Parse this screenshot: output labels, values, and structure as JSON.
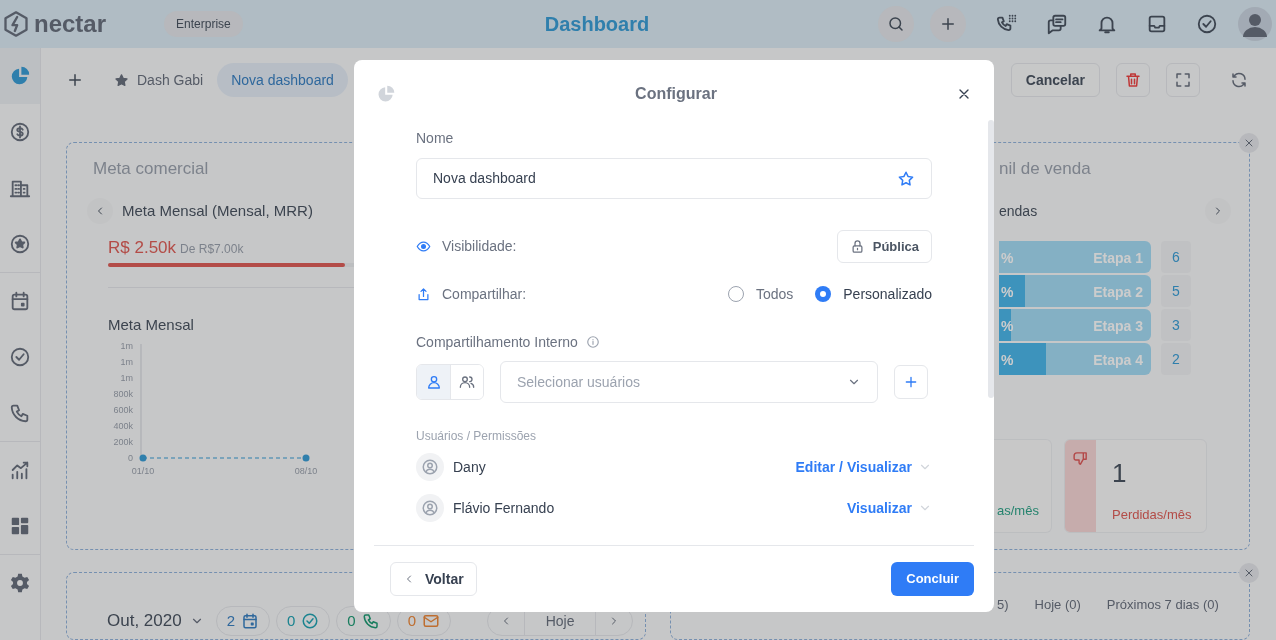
{
  "header": {
    "logo": "nectar",
    "plan": "Enterprise",
    "title": "Dashboard"
  },
  "sidebar": {
    "items": [
      {
        "selected": true
      },
      {
        "selected": false
      },
      {
        "selected": false
      },
      {
        "selected": false
      },
      {
        "selected": false
      },
      {
        "selected": false
      },
      {
        "selected": false
      },
      {
        "selected": false
      },
      {
        "selected": false
      },
      {
        "selected": false
      }
    ]
  },
  "toolbar": {
    "tabs": [
      {
        "label": "Dash Gabi",
        "favorite": true,
        "selected": false
      },
      {
        "label": "Nova dashboard",
        "favorite": false,
        "selected": true
      }
    ],
    "cancel": "Cancelar"
  },
  "meta_card": {
    "title": "Meta comercial",
    "goal": "Meta Mensal (Mensal, MRR)",
    "amount": "R$ 2.50k",
    "target": "De R$7.00k",
    "level": 0.47,
    "chart_title": "Meta Mensal",
    "chart_data": {
      "type": "line",
      "categories": [
        "01/10",
        "08/10"
      ],
      "series": [
        {
          "color": "#3b9fd8",
          "line_style": "dashed",
          "marker": "circle",
          "values": [
            0,
            0
          ]
        }
      ],
      "ylim": [
        0,
        1400000
      ],
      "yticks": [
        {
          "value": 0,
          "label": "0"
        },
        {
          "value": 200000,
          "label": "200k"
        },
        {
          "value": 400000,
          "label": "400k"
        },
        {
          "value": 600000,
          "label": "600k"
        },
        {
          "value": 800000,
          "label": "800k"
        },
        {
          "value": 1000000,
          "label": "1m"
        },
        {
          "value": 1200000,
          "label": "1m"
        },
        {
          "value": 1400000,
          "label": "1m"
        }
      ]
    }
  },
  "funnel_card": {
    "title": "nil de venda",
    "pipeline": "endas",
    "stages": [
      {
        "percent": "%",
        "label": "Etapa 1",
        "count": "6",
        "level": 0
      },
      {
        "percent": "%",
        "label": "Etapa 2",
        "count": "5",
        "level": 0.17
      },
      {
        "percent": "%",
        "label": "Etapa 3",
        "count": "3",
        "level": 0.08
      },
      {
        "percent": "%",
        "label": "Etapa 4",
        "count": "2",
        "level": 0.31
      }
    ],
    "stats": [
      {
        "kind": "won",
        "label": "as/mês"
      },
      {
        "kind": "lost",
        "value": "1",
        "label": "Perdidas/mês"
      }
    ]
  },
  "agenda_card": {
    "month": "Out, 2020",
    "counters": [
      {
        "kind": "events",
        "count": "2"
      },
      {
        "kind": "tasks",
        "count": "0"
      },
      {
        "kind": "calls",
        "count": "0"
      },
      {
        "kind": "emails",
        "count": "0"
      }
    ],
    "today": "Hoje"
  },
  "tasks_card": {
    "filters": [
      "5)",
      "Hoje (0)",
      "Próximos 7 dias (0)"
    ]
  },
  "modal": {
    "title": "Configurar",
    "name_label": "Nome",
    "name_value": "Nova dashboard",
    "favorite": false,
    "visibility_label": "Visibilidade:",
    "visibility_value": "Pública",
    "share_label": "Compartilhar:",
    "share_options": [
      {
        "label": "Todos",
        "selected": false
      },
      {
        "label": "Personalizado",
        "selected": true
      }
    ],
    "internal_label": "Compartilhamento Interno",
    "share_modes": [
      {
        "selected": true
      },
      {
        "selected": false
      }
    ],
    "user_select": {
      "placeholder": "Selecionar usuários"
    },
    "permissions_label": "Usuários / Permissões",
    "users": [
      {
        "name": "Dany",
        "permission": "Editar / Visualizar"
      },
      {
        "name": "Flávio Fernando",
        "permission": "Visualizar"
      }
    ],
    "back": "Voltar",
    "done": "Concluir"
  }
}
